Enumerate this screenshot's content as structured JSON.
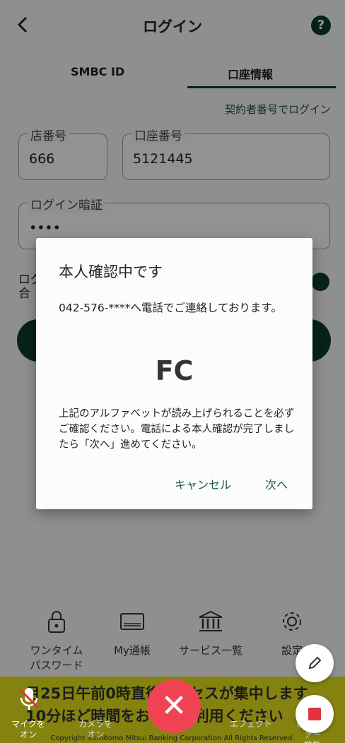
{
  "header": {
    "title": "ログイン",
    "back_icon": "chevron-left-icon",
    "help_label": "?"
  },
  "tabs": [
    {
      "label": "SMBC ID",
      "selected": false
    },
    {
      "label": "口座情報",
      "selected": true
    }
  ],
  "contract_login_link": "契約者番号でログイン",
  "form": {
    "branch_label": "店番号",
    "branch_value": "666",
    "account_label": "口座番号",
    "account_value": "5121445",
    "pin_label": "ログイン暗証",
    "pin_value": "••••",
    "partial_text_1": "ログ",
    "partial_text_2": "合"
  },
  "bottom_nav": [
    {
      "label_line1": "ワンタイム",
      "label_line2": "パスワード",
      "icon": "lock-icon"
    },
    {
      "label_line1": "My通帳",
      "label_line2": "",
      "icon": "card-icon"
    },
    {
      "label_line1": "サービス一覧",
      "label_line2": "",
      "icon": "bank-icon"
    },
    {
      "label_line1": "設定",
      "label_line2": "",
      "icon": "gear-icon"
    }
  ],
  "banner": {
    "line1": "月25日午前0時直後アクセスが集中します",
    "line2": "10分ほど時間をおいてご利用ください"
  },
  "copyright": "Copyright Sumitomo Mitsui Banking Corporation All Rights Reserved.",
  "call_controls": {
    "mic_label_1": "マイクを",
    "mic_label_2": "オン",
    "camera_label_1": "カメラを",
    "camera_label_2": "オン",
    "effects_label": "エフェクト",
    "viewfinder_label_1": "ビューファー",
    "viewfinder_label_2": "機能",
    "end_call_glyph": "✕"
  },
  "dialog": {
    "title": "本人確認中です",
    "phone_message": "042-576-****へ電話でご連絡しております。",
    "code": "FC",
    "instruction": "上記のアルファベットが読み上げられることを必ずご確認ください。電話による本人確認が完了しましたら「次へ」進めてください。",
    "cancel_label": "キャンセル",
    "next_label": "次へ"
  },
  "colors": {
    "brand_green": "#0d3b2e",
    "banner_yellow": "#e6e21a",
    "end_call_red": "#f04455"
  }
}
